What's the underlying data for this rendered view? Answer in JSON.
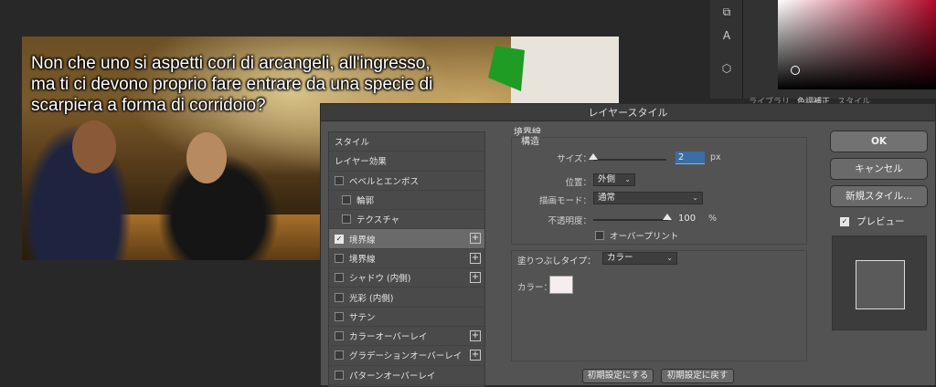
{
  "canvas": {
    "caption": "Non che uno si aspetti cori di arcangeli, all'ingresso,\nma ti ci devono proprio fare entrare da una specie di\nscarpiera a forma di corridoio?"
  },
  "panels": {
    "tabs": [
      "ライブラリ",
      "色調補正",
      "スタイル"
    ]
  },
  "dialog": {
    "title": "レイヤースタイル",
    "style_list": [
      {
        "label": "スタイル",
        "checkbox": false,
        "plus": false,
        "indent": false,
        "selected": false,
        "checked": false
      },
      {
        "label": "レイヤー効果",
        "checkbox": false,
        "plus": false,
        "indent": false,
        "selected": false,
        "checked": false
      },
      {
        "label": "ベベルとエンボス",
        "checkbox": true,
        "plus": false,
        "indent": false,
        "selected": false,
        "checked": false
      },
      {
        "label": "輪郭",
        "checkbox": true,
        "plus": false,
        "indent": true,
        "selected": false,
        "checked": false
      },
      {
        "label": "テクスチャ",
        "checkbox": true,
        "plus": false,
        "indent": true,
        "selected": false,
        "checked": false
      },
      {
        "label": "境界線",
        "checkbox": true,
        "plus": true,
        "indent": false,
        "selected": true,
        "checked": true
      },
      {
        "label": "境界線",
        "checkbox": true,
        "plus": true,
        "indent": false,
        "selected": false,
        "checked": false
      },
      {
        "label": "シャドウ (内側)",
        "checkbox": true,
        "plus": true,
        "indent": false,
        "selected": false,
        "checked": false
      },
      {
        "label": "光彩 (内側)",
        "checkbox": true,
        "plus": false,
        "indent": false,
        "selected": false,
        "checked": false
      },
      {
        "label": "サテン",
        "checkbox": true,
        "plus": false,
        "indent": false,
        "selected": false,
        "checked": false
      },
      {
        "label": "カラーオーバーレイ",
        "checkbox": true,
        "plus": true,
        "indent": false,
        "selected": false,
        "checked": false
      },
      {
        "label": "グラデーションオーバーレイ",
        "checkbox": true,
        "plus": true,
        "indent": false,
        "selected": false,
        "checked": false
      },
      {
        "label": "パターンオーバーレイ",
        "checkbox": true,
        "plus": false,
        "indent": false,
        "selected": false,
        "checked": false
      }
    ],
    "stroke": {
      "section_title": "境界線",
      "structure_title": "構造",
      "size_label": "サイズ：",
      "size_value": "2",
      "size_unit": "px",
      "position_label": "位置：",
      "position_value": "外側",
      "blend_label": "描画モード：",
      "blend_value": "通常",
      "opacity_label": "不透明度：",
      "opacity_value": "100",
      "opacity_unit": "%",
      "overprint_label": "オーバープリント",
      "fill_type_label": "塗りつぶしタイプ：",
      "fill_type_value": "カラー",
      "color_label": "カラー：",
      "color_value": "#f6eeee",
      "make_default_label": "初期設定にする",
      "reset_default_label": "初期設定に戻す"
    },
    "buttons": {
      "ok": "OK",
      "cancel": "キャンセル",
      "new_style": "新規スタイル...",
      "preview_label": "プレビュー"
    }
  }
}
